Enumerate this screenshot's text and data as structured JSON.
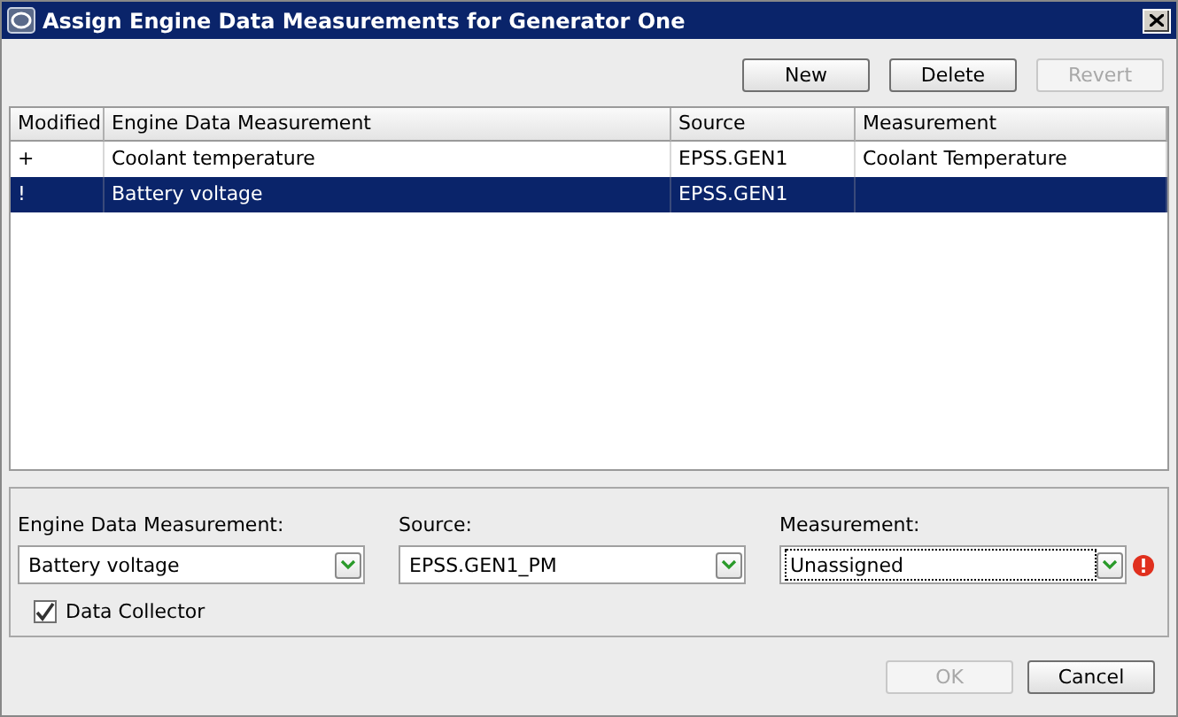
{
  "window": {
    "title": "Assign Engine Data Measurements for Generator One"
  },
  "toolbar": [
    {
      "label": "New",
      "disabled": false
    },
    {
      "label": "Delete",
      "disabled": false
    },
    {
      "label": "Revert",
      "disabled": true
    }
  ],
  "table": {
    "columns": [
      "Modified",
      "Engine Data Measurement",
      "Source",
      "Measurement"
    ],
    "rows": [
      {
        "cells": [
          "+",
          "Coolant temperature",
          "EPSS.GEN1",
          "Coolant Temperature"
        ],
        "selected": false
      },
      {
        "cells": [
          "!",
          "Battery voltage",
          "EPSS.GEN1",
          ""
        ],
        "selected": true
      }
    ]
  },
  "form": {
    "fields": [
      {
        "label": "Engine Data Measurement:",
        "value": "Battery voltage",
        "focused": false,
        "error": false
      },
      {
        "label": "Source:",
        "value": "EPSS.GEN1_PM",
        "focused": false,
        "error": false
      },
      {
        "label": "Measurement:",
        "value": "Unassigned",
        "focused": true,
        "error": true
      }
    ],
    "checkbox": {
      "label": "Data Collector",
      "checked": true
    }
  },
  "buttons": [
    {
      "label": "OK",
      "disabled": true
    },
    {
      "label": "Cancel",
      "disabled": false
    }
  ]
}
